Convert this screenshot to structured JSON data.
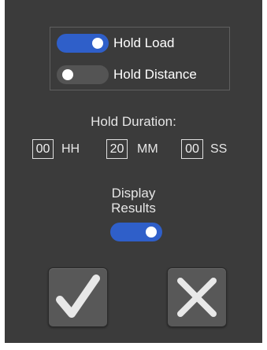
{
  "mode": {
    "hold_load": {
      "label": "Hold Load",
      "on": true
    },
    "hold_distance": {
      "label": "Hold Distance",
      "on": false
    }
  },
  "hold_duration": {
    "title": "Hold Duration:",
    "hours": {
      "value": "00",
      "unit": "HH"
    },
    "minutes": {
      "value": "20",
      "unit": "MM"
    },
    "seconds": {
      "value": "00",
      "unit": "SS"
    }
  },
  "display_results": {
    "line1": "Display",
    "line2": "Results",
    "on": true
  },
  "actions": {
    "confirm_icon": "check-icon",
    "cancel_icon": "close-icon"
  },
  "colors": {
    "panel": "#3b3b3b",
    "toggle_on": "#2f5fc9",
    "toggle_off": "#545454",
    "button": "#585858",
    "icon": "#e8e8e8"
  }
}
